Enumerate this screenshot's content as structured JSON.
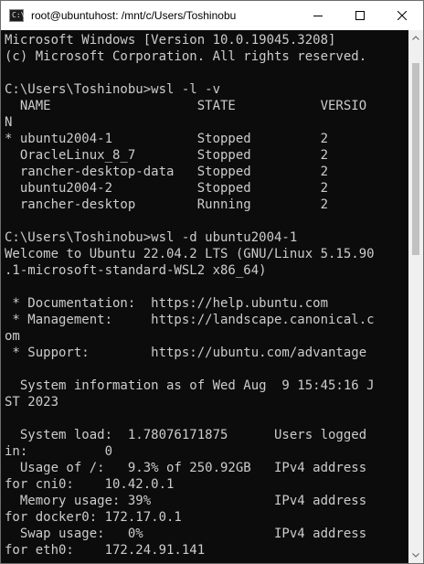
{
  "window": {
    "title": "root@ubuntuhost: /mnt/c/Users/Toshinobu",
    "icon_label": "C:\\",
    "minimize_icon": "minimize-icon",
    "maximize_icon": "maximize-icon",
    "close_icon": "close-icon"
  },
  "console": {
    "lines": [
      "Microsoft Windows [Version 10.0.19045.3208]",
      "(c) Microsoft Corporation. All rights reserved.",
      "",
      "C:\\Users\\Toshinobu>wsl -l -v",
      "  NAME                   STATE           VERSIO",
      "N",
      "* ubuntu2004-1           Stopped         2",
      "  OracleLinux_8_7        Stopped         2",
      "  rancher-desktop-data   Stopped         2",
      "  ubuntu2004-2           Stopped         2",
      "  rancher-desktop        Running         2",
      "",
      "C:\\Users\\Toshinobu>wsl -d ubuntu2004-1",
      "Welcome to Ubuntu 22.04.2 LTS (GNU/Linux 5.15.90",
      ".1-microsoft-standard-WSL2 x86_64)",
      "",
      " * Documentation:  https://help.ubuntu.com",
      " * Management:     https://landscape.canonical.c",
      "om",
      " * Support:        https://ubuntu.com/advantage",
      "",
      "  System information as of Wed Aug  9 15:45:16 J",
      "ST 2023",
      "",
      "  System load:  1.78076171875      Users logged",
      "in:          0",
      "  Usage of /:   9.3% of 250.92GB   IPv4 address",
      "for cni0:    10.42.0.1",
      "  Memory usage: 39%                IPv4 address",
      "for docker0: 172.17.0.1",
      "  Swap usage:   0%                 IPv4 address",
      "for eth0:    172.24.91.141"
    ]
  },
  "colors": {
    "console_bg": "#0c0c0c",
    "console_fg": "#cccccc",
    "titlebar_bg": "#ffffff"
  }
}
